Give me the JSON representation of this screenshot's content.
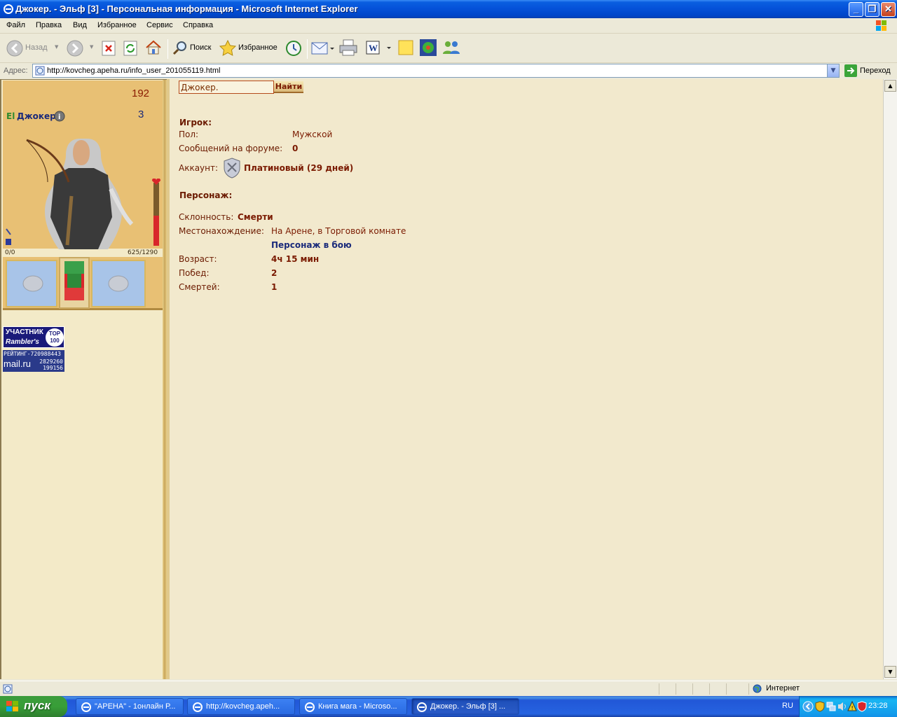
{
  "window": {
    "title": "Джокер. - Эльф [3] - Персональная информация - Microsoft Internet Explorer"
  },
  "menu": [
    "Файл",
    "Правка",
    "Вид",
    "Избранное",
    "Сервис",
    "Справка"
  ],
  "toolbar": {
    "back": "Назад",
    "search": "Поиск",
    "favorites": "Избранное"
  },
  "address": {
    "label": "Адрес:",
    "url": "http://kovcheg.apeha.ru/info_user_201055119.html",
    "go": "Переход"
  },
  "character": {
    "level_stat": "192",
    "clan_tag": "El",
    "name": "Джокер.",
    "level": "3",
    "mana": "0/0",
    "hp": "625/1290",
    "hp_fraction": 0.48,
    "mana_fraction": 0.0
  },
  "badges": {
    "rambler_line1": "УЧАСТНИК",
    "rambler_line2": "Rambler's",
    "rambler_top": "TOP",
    "rambler_100": "100",
    "mail_rating": "РЕЙТИНГ-720988443",
    "mail_brand": "mail.ru",
    "mail_n1": "2829260",
    "mail_n2": "199156"
  },
  "search": {
    "value": "Джокер.",
    "button": "Найти"
  },
  "player": {
    "heading": "Игрок:",
    "gender_label": "Пол:",
    "gender": "Мужской",
    "posts_label": "Сообщений на форуме:",
    "posts": "0",
    "account_label": "Аккаунт:",
    "account": "Платиновый (29 дней)"
  },
  "persona": {
    "heading": "Персонаж:",
    "alignment_label": "Склонность:",
    "alignment": "Смерти",
    "location_label": "Местонахождение:",
    "location": "На Арене, в Торговой комнате",
    "in_battle": "Персонаж в бою",
    "age_label": "Возраст:",
    "age": "4ч 15 мин",
    "wins_label": "Побед:",
    "wins": "2",
    "deaths_label": "Смертей:",
    "deaths": "1"
  },
  "status": {
    "zone": "Интернет"
  },
  "taskbar": {
    "start": "пуск",
    "tasks": [
      "\"АРЕНА\" - 1онлайн Р...",
      "http://kovcheg.apeh...",
      "Книга мага - Microso...",
      "Джокер. - Эльф [3] ..."
    ],
    "lang": "RU",
    "clock": "23:28"
  },
  "colors": {
    "title_blue": "#0552D9",
    "page_bg": "#F2E9CD",
    "text_red": "#7A1A00",
    "text_blue": "#1A2A7A",
    "start_green": "#389E38"
  }
}
